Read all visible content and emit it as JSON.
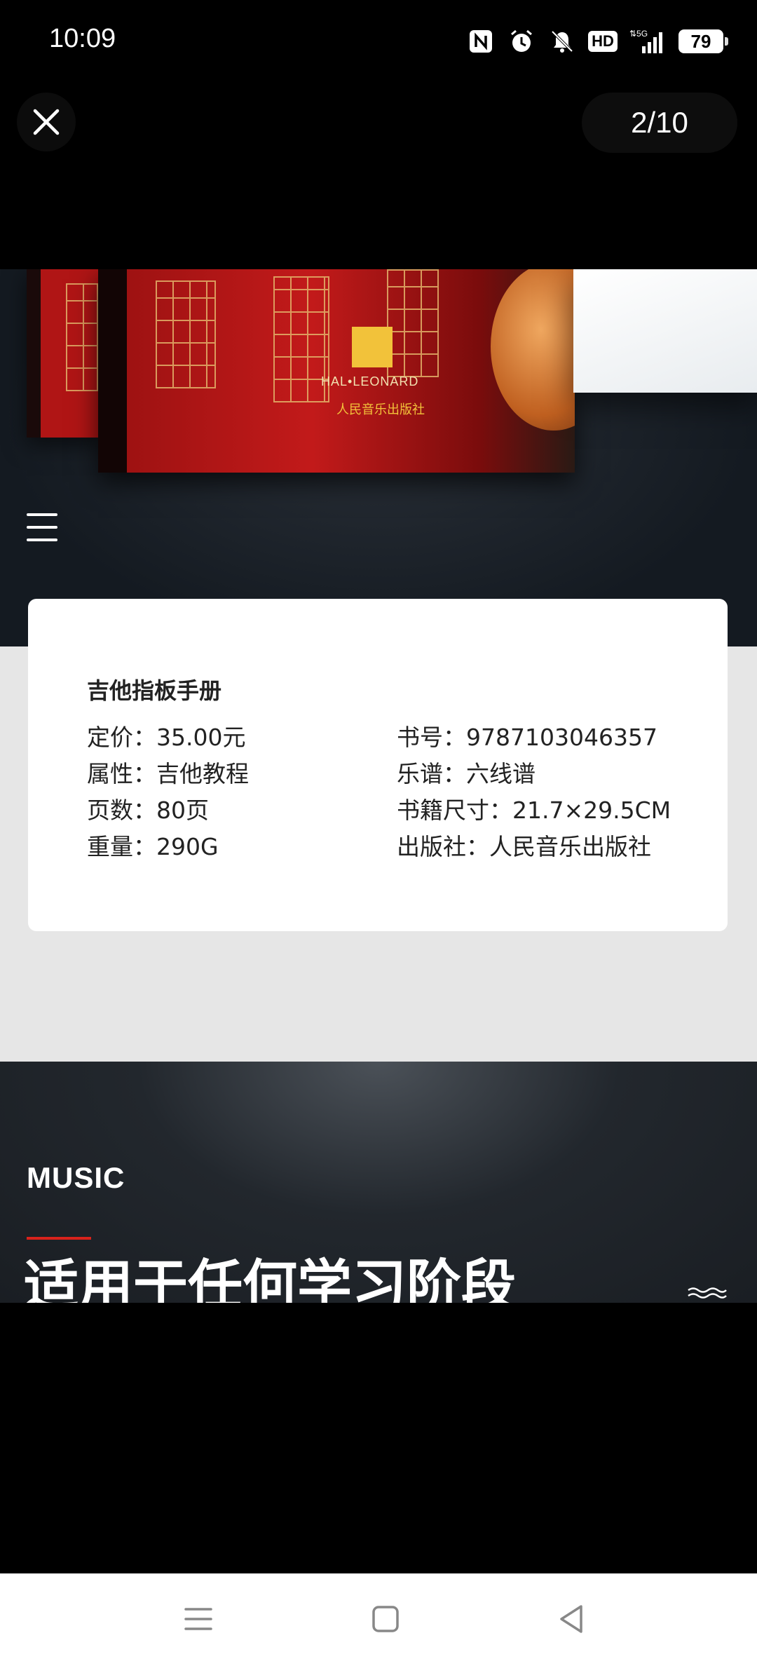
{
  "status_bar": {
    "time": "10:09",
    "icons": [
      "nfc-icon",
      "alarm-icon",
      "mute-icon",
      "hd-icon",
      "5g-signal-icon",
      "battery-icon"
    ],
    "hd_label": "HD",
    "network": "5G",
    "battery": "79"
  },
  "viewer": {
    "close_icon": "close-icon",
    "counter": "2/10"
  },
  "product_image": {
    "brand_text": "HAL•LEONARD",
    "publisher_text": "人民音乐出版社",
    "menu_icon": "hamburger-icon"
  },
  "info_card": {
    "title": "吉他指板手册",
    "left": [
      "定价：35.00元",
      "属性：吉他教程",
      "页数：80页",
      "重量：290G"
    ],
    "right": [
      "书号：9787103046357",
      "乐谱：六线谱",
      "书籍尺寸：21.7×29.5CM",
      "出版社：人民音乐出版社"
    ]
  },
  "section": {
    "label": "MUSIC",
    "headline": "适用于任何学习阶段",
    "wave_icon": "wave-icon"
  },
  "nav_bar": {
    "items": [
      "menu-nav-icon",
      "home-nav-icon",
      "back-nav-icon"
    ]
  },
  "colors": {
    "accent_red": "#d8221b",
    "book_red": "#c21a1a",
    "logo_yellow": "#f2c23a"
  }
}
